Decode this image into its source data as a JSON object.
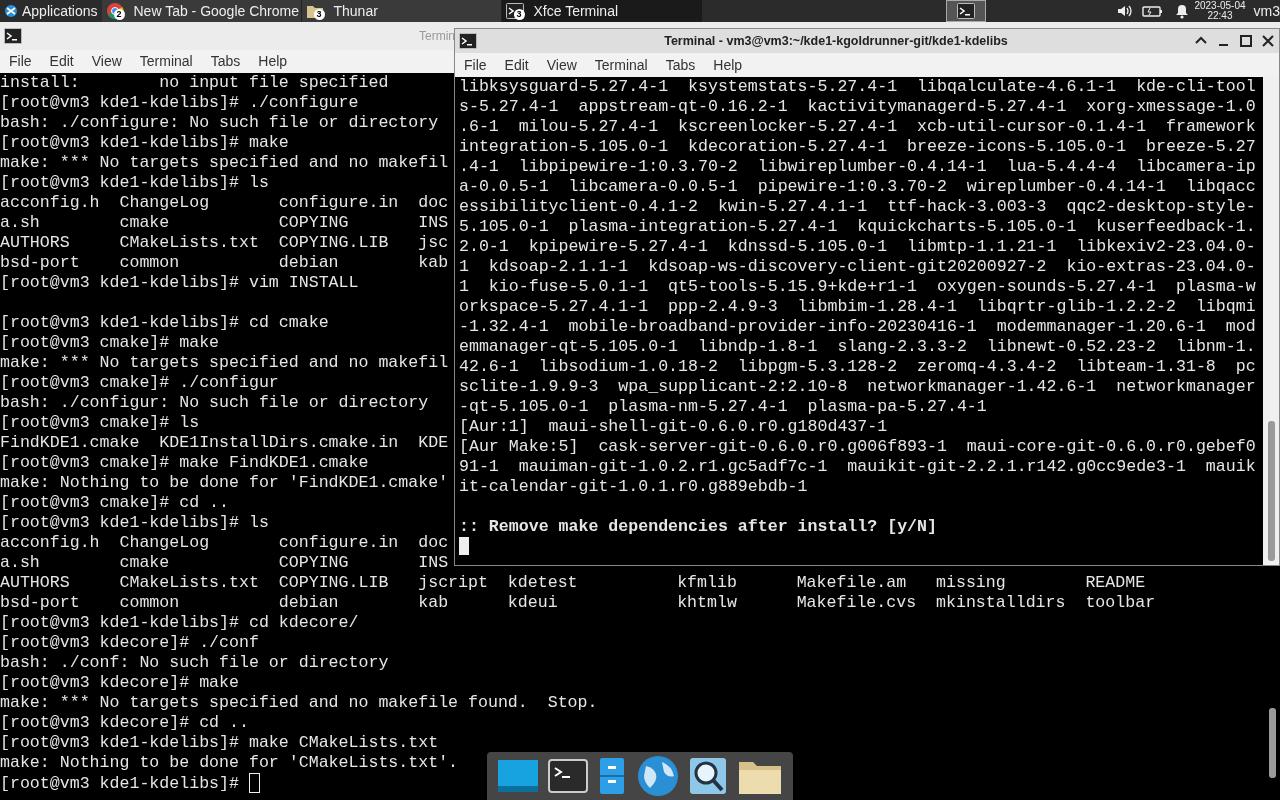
{
  "panel": {
    "menu": "Applications",
    "tasks": [
      {
        "kind": "browser",
        "label": "New Tab - Google Chrome",
        "badge": "2",
        "selected": false
      },
      {
        "kind": "files",
        "label": "Thunar",
        "badge": "3",
        "selected": false
      },
      {
        "kind": "terminal",
        "label": "Xfce Terminal",
        "badge": "3",
        "selected": true
      }
    ],
    "clock": {
      "date": "2023-05-04",
      "time": "22:43"
    },
    "user": "vm3"
  },
  "back_window": {
    "title": "Termin",
    "focused": false,
    "menu": [
      "File",
      "Edit",
      "View",
      "Terminal",
      "Tabs",
      "Help"
    ],
    "lines": [
      {
        "kind": "text",
        "text": "install:        no input file specified"
      },
      {
        "kind": "text",
        "text": "[root@vm3 kde1-kdelibs]# ./configure"
      },
      {
        "kind": "text",
        "text": "bash: ./configure: No such file or directory"
      },
      {
        "kind": "text",
        "text": "[root@vm3 kde1-kdelibs]# make"
      },
      {
        "kind": "text",
        "text": "make: *** No targets specified and no makefil"
      },
      {
        "kind": "text",
        "text": "[root@vm3 kde1-kdelibs]# ls"
      },
      {
        "kind": "text",
        "text": "acconfig.h  ChangeLog       configure.in  doc"
      },
      {
        "kind": "text",
        "text": "a.sh        cmake           COPYING       INS"
      },
      {
        "kind": "text",
        "text": "AUTHORS     CMakeLists.txt  COPYING.LIB   jsc"
      },
      {
        "kind": "text",
        "text": "bsd-port    common          debian        kab"
      },
      {
        "kind": "text",
        "text": "[root@vm3 kde1-kdelibs]# vim INSTALL"
      },
      {
        "kind": "blank"
      },
      {
        "kind": "text",
        "text": "[root@vm3 kde1-kdelibs]# cd cmake"
      },
      {
        "kind": "text",
        "text": "[root@vm3 cmake]# make"
      },
      {
        "kind": "text",
        "text": "make: *** No targets specified and no makefil"
      },
      {
        "kind": "text",
        "text": "[root@vm3 cmake]# ./configur"
      },
      {
        "kind": "text",
        "text": "bash: ./configur: No such file or directory"
      },
      {
        "kind": "text",
        "text": "[root@vm3 cmake]# ls"
      },
      {
        "kind": "text",
        "text": "FindKDE1.cmake  KDE1InstallDirs.cmake.in  KDE"
      },
      {
        "kind": "text",
        "text": "[root@vm3 cmake]# make FindKDE1.cmake"
      },
      {
        "kind": "text",
        "text": "make: Nothing to be done for 'FindKDE1.cmake'"
      },
      {
        "kind": "text",
        "text": "[root@vm3 cmake]# cd .."
      },
      {
        "kind": "text",
        "text": "[root@vm3 kde1-kdelibs]# ls"
      },
      {
        "kind": "text",
        "text": "acconfig.h  ChangeLog       configure.in  doc"
      },
      {
        "kind": "text",
        "text": "a.sh        cmake           COPYING       INS"
      },
      {
        "kind": "text",
        "text": "AUTHORS     CMakeLists.txt  COPYING.LIB   jscript  kdetest          kfmlib      Makefile.am   missing        README"
      },
      {
        "kind": "text",
        "text": "bsd-port    common          debian        kab      kdeui            khtmlw      Makefile.cvs  mkinstalldirs  toolbar"
      },
      {
        "kind": "text",
        "text": "[root@vm3 kde1-kdelibs]# cd kdecore/"
      },
      {
        "kind": "text",
        "text": "[root@vm3 kdecore]# ./conf"
      },
      {
        "kind": "text",
        "text": "bash: ./conf: No such file or directory"
      },
      {
        "kind": "text",
        "text": "[root@vm3 kdecore]# make"
      },
      {
        "kind": "text",
        "text": "make: *** No targets specified and no makefile found.  Stop."
      },
      {
        "kind": "text",
        "text": "[root@vm3 kdecore]# cd .."
      },
      {
        "kind": "text",
        "text": "[root@vm3 kde1-kdelibs]# make CMakeLists.txt"
      },
      {
        "kind": "text",
        "text": "make: Nothing to be done for 'CMakeLists.txt'."
      },
      {
        "kind": "prompt",
        "text": "[root@vm3 kde1-kdelibs]# "
      }
    ]
  },
  "front_window": {
    "title": "Terminal - vm3@vm3:~/kde1-kgoldrunner-git/kde1-kdelibs",
    "focused": true,
    "menu": [
      "File",
      "Edit",
      "View",
      "Terminal",
      "Tabs",
      "Help"
    ],
    "lines": [
      {
        "kind": "text",
        "text": "libksysguard-5.27.4-1  ksystemstats-5.27.4-1  libqalculate-4.6.1-1  kde-cli-tool"
      },
      {
        "kind": "text",
        "text": "s-5.27.4-1  appstream-qt-0.16.2-1  kactivitymanagerd-5.27.4-1  xorg-xmessage-1.0"
      },
      {
        "kind": "text",
        "text": ".6-1  milou-5.27.4-1  kscreenlocker-5.27.4-1  xcb-util-cursor-0.1.4-1  framework"
      },
      {
        "kind": "text",
        "text": "integration-5.105.0-1  kdecoration-5.27.4-1  breeze-icons-5.105.0-1  breeze-5.27"
      },
      {
        "kind": "text",
        "text": ".4-1  libpipewire-1:0.3.70-2  libwireplumber-0.4.14-1  lua-5.4.4-4  libcamera-ip"
      },
      {
        "kind": "text",
        "text": "a-0.0.5-1  libcamera-0.0.5-1  pipewire-1:0.3.70-2  wireplumber-0.4.14-1  libqacc"
      },
      {
        "kind": "text",
        "text": "essibilityclient-0.4.1-2  kwin-5.27.4.1-1  ttf-hack-3.003-3  qqc2-desktop-style-"
      },
      {
        "kind": "text",
        "text": "5.105.0-1  plasma-integration-5.27.4-1  kquickcharts-5.105.0-1  kuserfeedback-1."
      },
      {
        "kind": "text",
        "text": "2.0-1  kpipewire-5.27.4-1  kdnssd-5.105.0-1  libmtp-1.1.21-1  libkexiv2-23.04.0-"
      },
      {
        "kind": "text",
        "text": "1  kdsoap-2.1.1-1  kdsoap-ws-discovery-client-git20200927-2  kio-extras-23.04.0-"
      },
      {
        "kind": "text",
        "text": "1  kio-fuse-5.0.1-1  qt5-tools-5.15.9+kde+r1-1  oxygen-sounds-5.27.4-1  plasma-w"
      },
      {
        "kind": "text",
        "text": "orkspace-5.27.4.1-1  ppp-2.4.9-3  libmbim-1.28.4-1  libqrtr-glib-1.2.2-2  libqmi"
      },
      {
        "kind": "text",
        "text": "-1.32.4-1  mobile-broadband-provider-info-20230416-1  modemmanager-1.20.6-1  mod"
      },
      {
        "kind": "text",
        "text": "emmanager-qt-5.105.0-1  libndp-1.8-1  slang-2.3.3-2  libnewt-0.52.23-2  libnm-1."
      },
      {
        "kind": "text",
        "text": "42.6-1  libsodium-1.0.18-2  libpgm-5.3.128-2  zeromq-4.3.4-2  libteam-1.31-8  pc"
      },
      {
        "kind": "text",
        "text": "sclite-1.9.9-3  wpa_supplicant-2:2.10-8  networkmanager-1.42.6-1  networkmanager"
      },
      {
        "kind": "text",
        "text": "-qt-5.105.0-1  plasma-nm-5.27.4-1  plasma-pa-5.27.4-1"
      },
      {
        "kind": "text",
        "text": "[Aur:1]  maui-shell-git-0.6.0.r0.g180d437-1"
      },
      {
        "kind": "text",
        "text": "[Aur Make:5]  cask-server-git-0.6.0.r0.g006f893-1  maui-core-git-0.6.0.r0.gebef0"
      },
      {
        "kind": "text",
        "text": "91-1  mauiman-git-1.0.2.r1.gc5adf7c-1  mauikit-git-2.2.1.r142.g0cc9ede3-1  mauik"
      },
      {
        "kind": "text",
        "text": "it-calendar-git-1.0.1.r0.g889ebdb-1"
      },
      {
        "kind": "blank"
      },
      {
        "kind": "bold",
        "text": ":: Remove make dependencies after install? [y/N]"
      },
      {
        "kind": "prompt"
      }
    ]
  }
}
